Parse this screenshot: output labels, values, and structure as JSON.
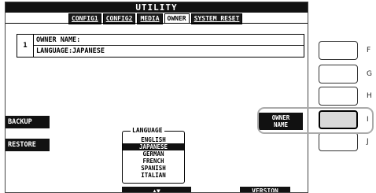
{
  "screen": {
    "title": "UTILITY",
    "tabs": [
      {
        "label": "CONFIG1",
        "active": false
      },
      {
        "label": "CONFIG2",
        "active": false
      },
      {
        "label": "MEDIA",
        "active": false
      },
      {
        "label": "OWNER",
        "active": true
      },
      {
        "label": "SYSTEM RESET",
        "active": false
      }
    ],
    "info": {
      "number": "1",
      "owner_line": "OWNER NAME:",
      "language_line": "LANGUAGE:JAPANESE"
    },
    "left_buttons": {
      "backup": "BACKUP",
      "restore": "RESTORE"
    },
    "owner_name_button": {
      "line1": "OWNER",
      "line2": "NAME"
    },
    "language_selector": {
      "title": "LANGUAGE",
      "options": [
        "ENGLISH",
        "JAPANESE",
        "GERMAN",
        "FRENCH",
        "SPANISH",
        "ITALIAN"
      ],
      "selected": "JAPANESE"
    },
    "arrows_label": "▲▼",
    "version_label": "VERSION"
  },
  "side_buttons": [
    {
      "label": "F"
    },
    {
      "label": "G"
    },
    {
      "label": "H"
    },
    {
      "label": "I",
      "highlighted": true
    },
    {
      "label": "J"
    }
  ],
  "colors": {
    "lcd_dark": "#111111",
    "highlight_fill": "#d9d9d9",
    "callout": "#aaaaaa"
  }
}
